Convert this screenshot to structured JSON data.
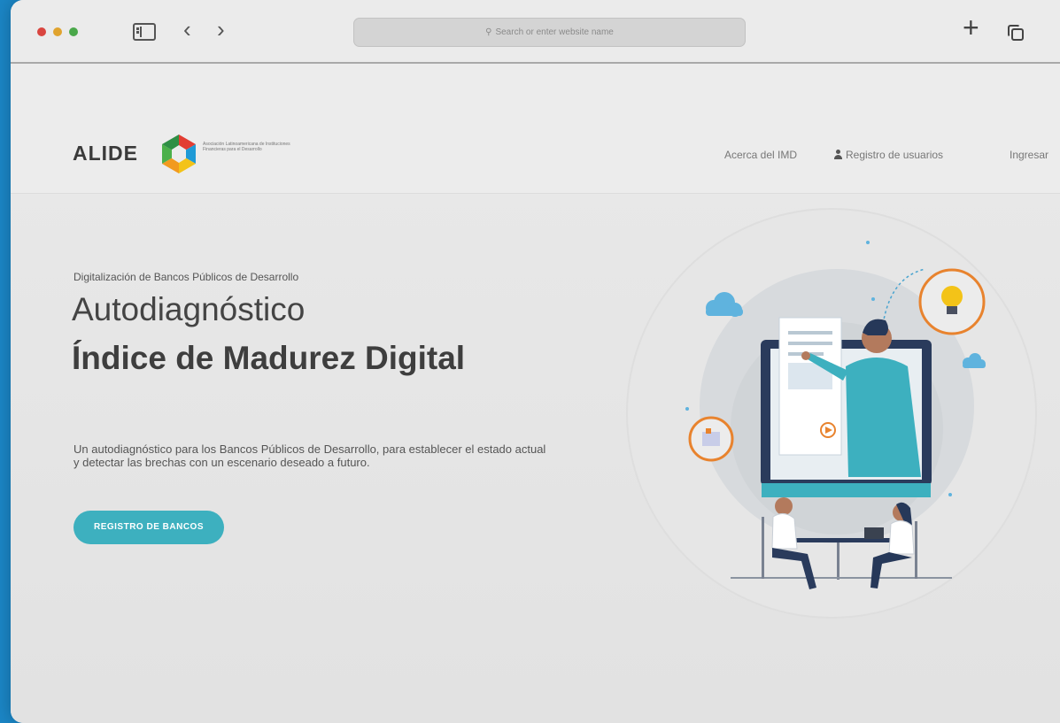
{
  "browser": {
    "address_placeholder": "Search or enter website name"
  },
  "header": {
    "logo_text": "ALIDE",
    "logo_tagline": "Asociación Latinoamericana de Instituciones Financieras para el Desarrollo",
    "nav": {
      "about": "Acerca del IMD",
      "register_users": "Registro de usuarios",
      "login": "Ingresar"
    }
  },
  "hero": {
    "kicker": "Digitalización de Bancos Públicos de Desarrollo",
    "title_line1": "Autodiagnóstico",
    "title_line2": "Índice de Madurez Digital",
    "description": "Un autodiagnóstico para los Bancos Públicos de Desarrollo, para establecer el estado actual y detectar las brechas con un escenario deseado a futuro.",
    "cta_label": "REGISTRO DE BANCOS"
  },
  "colors": {
    "accent": "#3db0bf",
    "background_outer": "#1b86c6",
    "orange": "#e8832e"
  }
}
